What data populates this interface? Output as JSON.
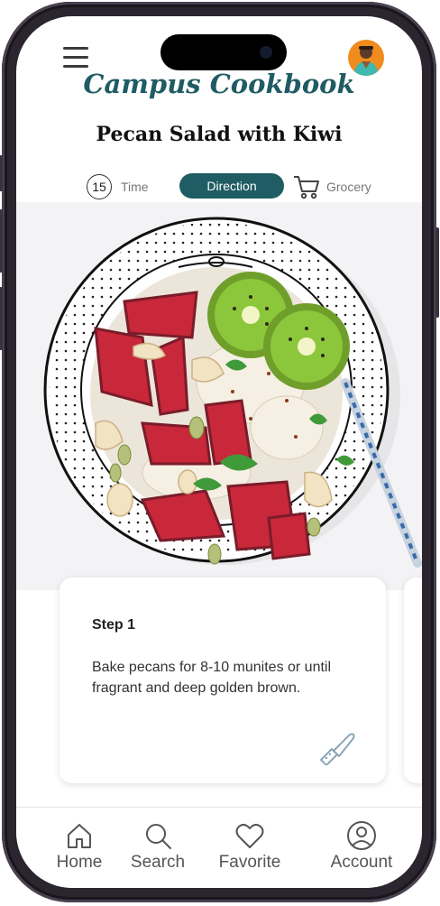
{
  "header": {
    "app_title": "Campus Cookbook",
    "recipe_title": "Pecan Salad with Kiwi"
  },
  "tabs": {
    "time_value": "15",
    "time_label": "Time",
    "direction_label": "Direction",
    "grocery_label": "Grocery",
    "active": "Direction"
  },
  "step": {
    "title": "Step 1",
    "text": "Bake pecans for 8-10 munites or until fragrant and deep golden brown."
  },
  "nav": {
    "items": [
      {
        "label": "Home",
        "icon": "home-icon"
      },
      {
        "label": "Search",
        "icon": "search-icon"
      },
      {
        "label": "Favorite",
        "icon": "heart-icon"
      },
      {
        "label": "Account",
        "icon": "account-icon"
      }
    ]
  },
  "colors": {
    "accent": "#1f5c63",
    "avatar_bg": "#ef8c1d"
  }
}
